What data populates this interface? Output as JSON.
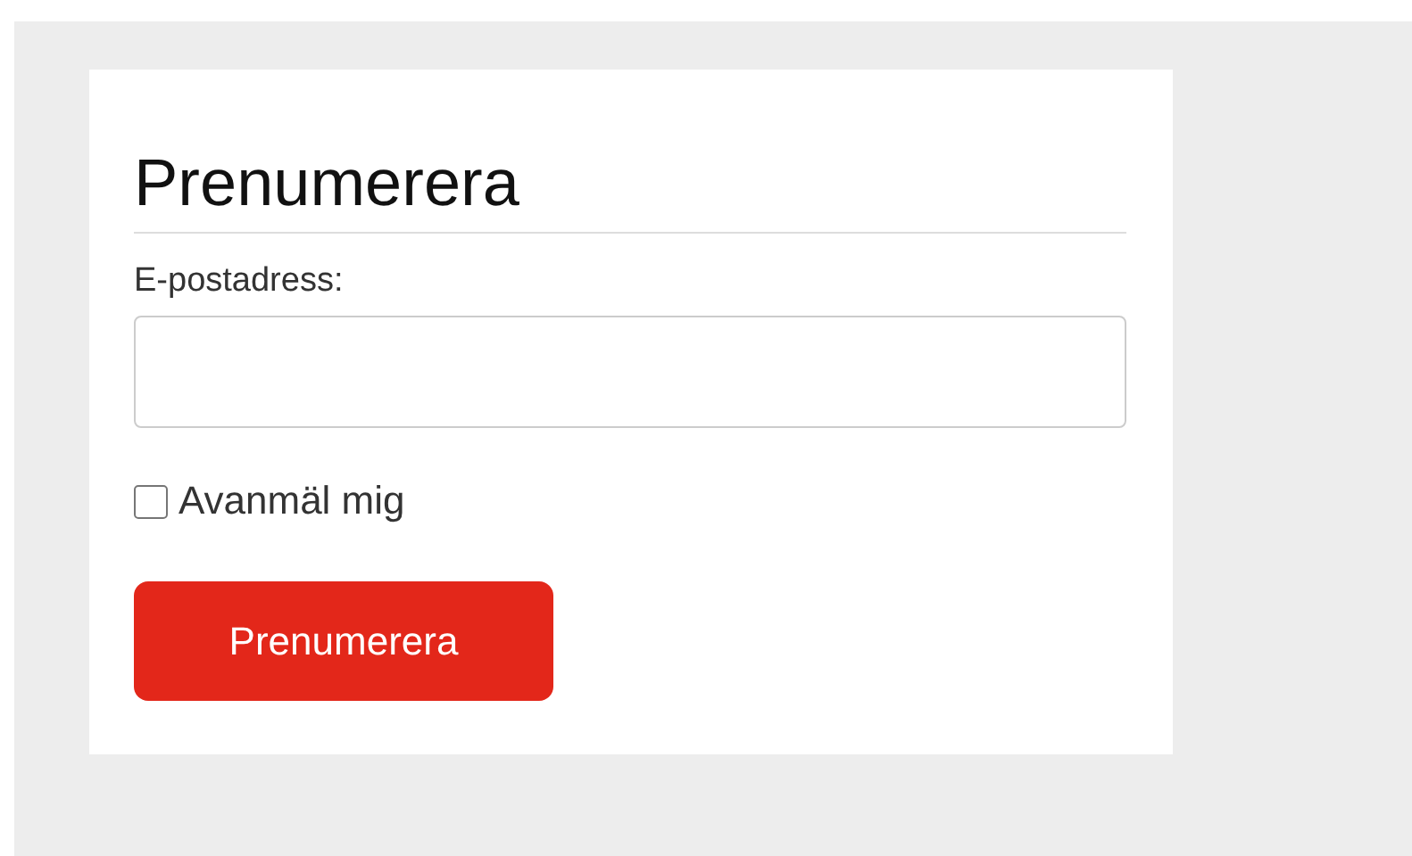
{
  "form": {
    "title": "Prenumerera",
    "email_field": {
      "label": "E-postadress:"
    },
    "unsubscribe": {
      "label": "Avanmäl mig",
      "checked": false
    },
    "submit_button": "Prenumerera"
  }
}
